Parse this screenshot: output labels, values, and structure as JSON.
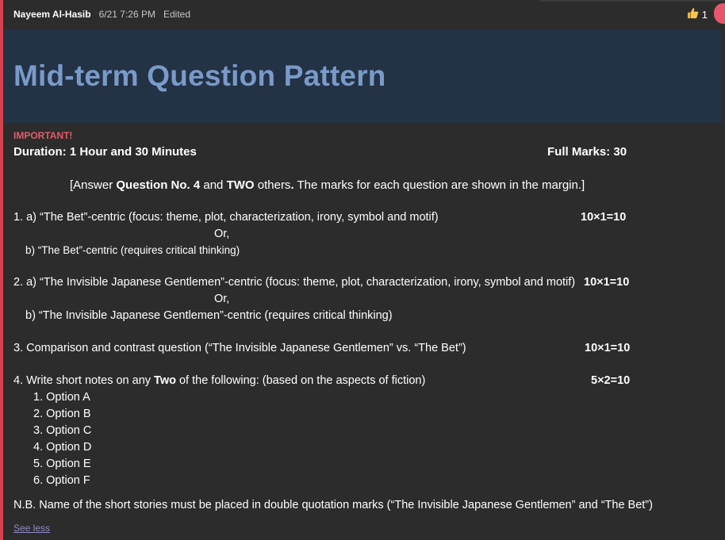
{
  "message": {
    "author": "Nayeem Al-Hasib",
    "timestamp": "6/21 7:26 PM",
    "status": "Edited",
    "reaction": {
      "icon": "thumbs-up-icon",
      "count": "1"
    }
  },
  "banner": {
    "title": "Mid-term Question Pattern"
  },
  "notice": {
    "important": "IMPORTANT!",
    "duration": "Duration: 1 Hour and 30 Minutes",
    "full_marks": "Full Marks: 30"
  },
  "instruction": {
    "part1": "[Answer ",
    "bold1": "Question No. 4",
    "part2": " and ",
    "bold2": "TWO",
    "part3": " others",
    "bold3": ".",
    "part4": " The marks for each question are shown in the margin.]"
  },
  "questions": {
    "q1a": "1. a) “The Bet”-centric (focus: theme, plot, characterization, irony, symbol and motif)",
    "q1_or": "Or,",
    "q1b": "b) “The Bet”-centric (requires critical thinking)",
    "q1_marks": "10×1=10",
    "q2a": "2. a) “The Invisible Japanese Gentlemen”-centric (focus: theme, plot, characterization, irony, symbol and motif)",
    "q2_or": "Or,",
    "q2b": "b) “The Invisible Japanese Gentlemen”-centric (requires critical thinking)",
    "q2_marks": "10×1=10",
    "q3": "3. Comparison and contrast question (“The Invisible Japanese Gentlemen” vs. “The Bet”)",
    "q3_marks": "10×1=10",
    "q4_part1": "4. Write short notes on any ",
    "q4_bold": "Two",
    "q4_part2": " of the following: (based on the aspects of fiction)",
    "q4_marks": "5×2=10",
    "options": [
      "1. Option A",
      "2. Option B",
      "3. Option C",
      "4. Option D",
      "5. Option E",
      "6. Option F"
    ]
  },
  "note": "N.B. Name of the short stories must be placed in double quotation marks (“The Invisible Japanese Gentlemen” and “The Bet”)",
  "see_less": "See less",
  "colors": {
    "accent": "#d3424f",
    "banner_bg": "#233245",
    "title": "#7a9ac9",
    "important": "#e05c6b",
    "link": "#8b8cc7"
  }
}
